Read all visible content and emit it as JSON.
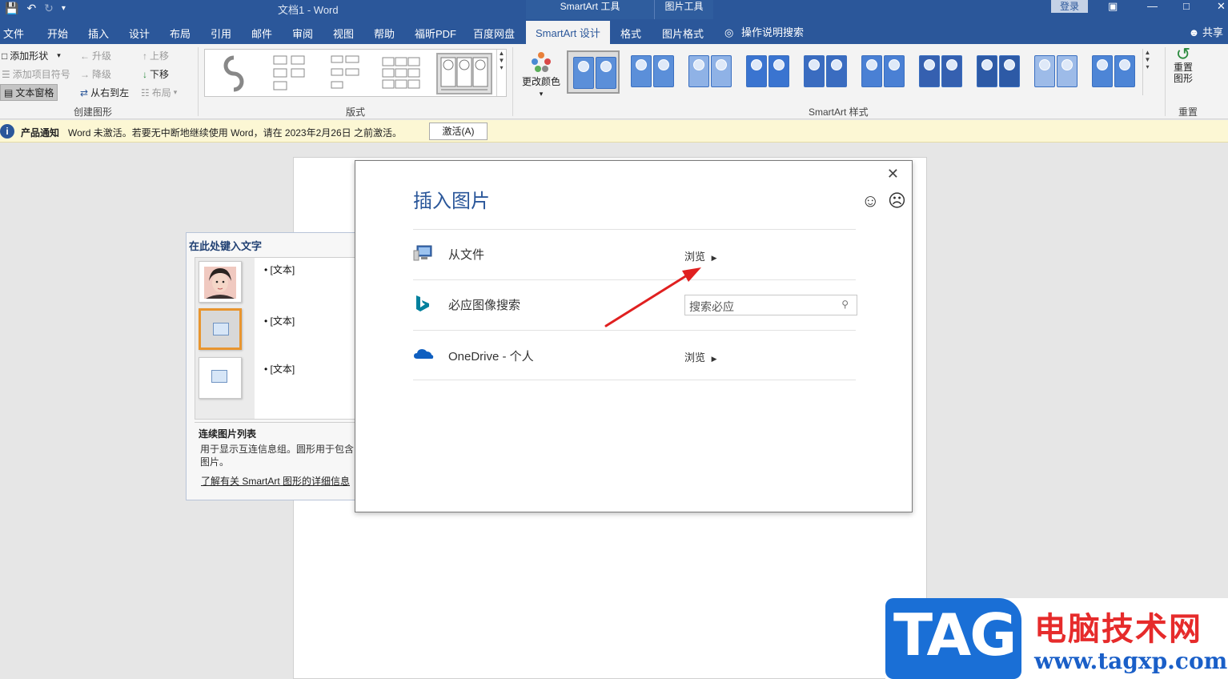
{
  "window": {
    "title": "文档1  -  Word",
    "context_tabs": {
      "smartart_tools": "SmartArt 工具",
      "picture_tools": "图片工具"
    },
    "login": "登录",
    "share": "共享"
  },
  "ribbon_tabs": [
    "文件",
    "开始",
    "插入",
    "设计",
    "布局",
    "引用",
    "邮件",
    "审阅",
    "视图",
    "帮助",
    "福昕PDF",
    "百度网盘",
    "SmartArt 设计",
    "格式",
    "图片格式"
  ],
  "active_tab": "SmartArt 设计",
  "tell_me": "操作说明搜索",
  "ribbon": {
    "create_graphic": {
      "label": "创建图形",
      "add_shape": "添加形状",
      "add_bullet": "添加项目符号",
      "text_pane": "文本窗格",
      "promote": "升级",
      "demote": "降级",
      "right_to_left": "从右到左",
      "move_up": "上移",
      "move_down": "下移",
      "layout": "布局"
    },
    "layouts": {
      "label": "版式"
    },
    "smartart_styles": {
      "label": "SmartArt 样式",
      "change_colors": "更改颜色"
    },
    "reset": {
      "label": "重置",
      "reset_graphic": "重置\n图形"
    }
  },
  "notice": {
    "title": "产品通知",
    "message": "Word 未激活。若要无中断地继续使用 Word，请在 2023年2月26日 之前激活。",
    "activate": "激活(A)"
  },
  "text_pane": {
    "header": "在此处键入文字",
    "bullets": [
      "[文本]",
      "[文本]",
      "[文本]"
    ],
    "desc_title": "连续图片列表",
    "desc": "用于显示互连信息组。圆形用于包含图片。",
    "link": "了解有关 SmartArt 图形的详细信息"
  },
  "dialog": {
    "title": "插入图片",
    "rows": [
      {
        "label": "从文件",
        "action": "浏览",
        "icon": "computer-icon"
      },
      {
        "label": "必应图像搜索",
        "search_placeholder": "搜索必应",
        "icon": "bing-icon"
      },
      {
        "label": "OneDrive - 个人",
        "action": "浏览",
        "icon": "onedrive-cloud-icon"
      }
    ]
  },
  "watermark": {
    "logo": "TAG",
    "site_name": "电脑技术网",
    "url": "www.tagxp.com"
  },
  "colors": {
    "accent": "#2b579a",
    "notice_bg": "#fcf7d4",
    "arrow": "#e02020"
  }
}
